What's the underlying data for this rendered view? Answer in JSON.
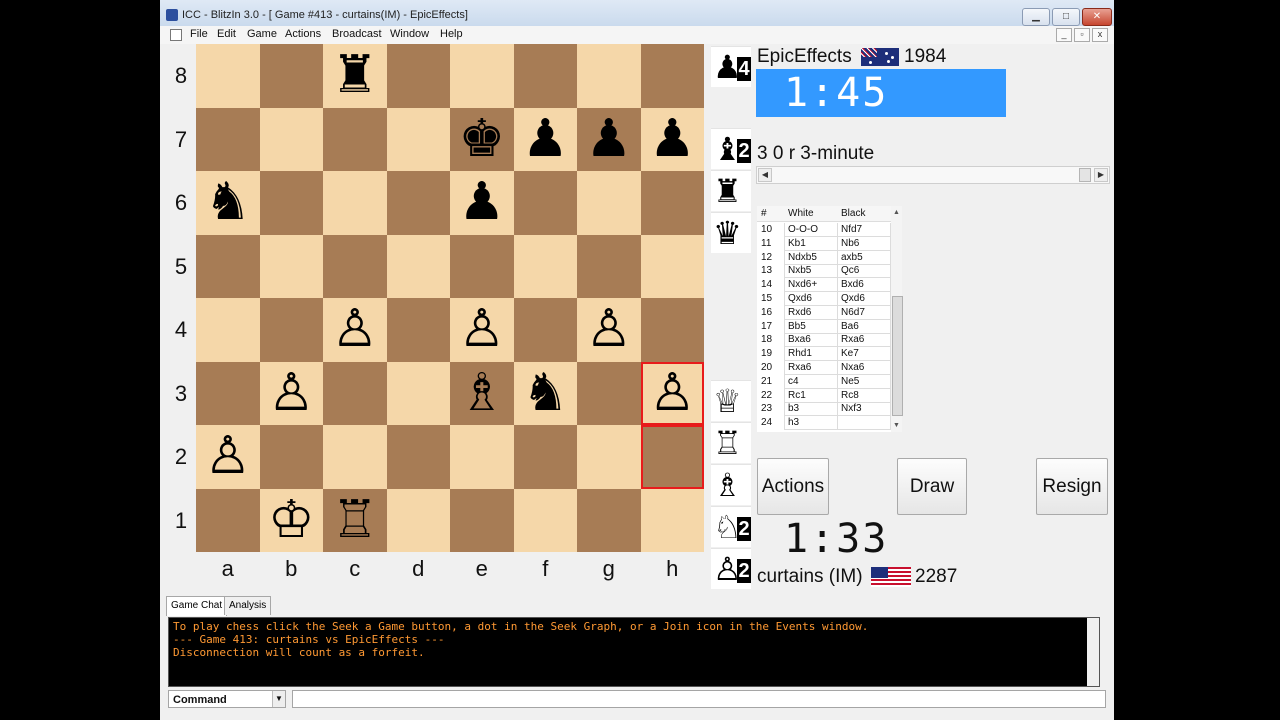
{
  "window": {
    "title": "ICC - BlitzIn 3.0 - [ Game #413 - curtains(IM) - EpicEffects]",
    "menu": [
      "File",
      "Edit",
      "Game",
      "Actions",
      "Broadcast",
      "Window",
      "Help"
    ]
  },
  "board": {
    "ranks": [
      "8",
      "7",
      "6",
      "5",
      "4",
      "3",
      "2",
      "1"
    ],
    "files": [
      "a",
      "b",
      "c",
      "d",
      "e",
      "f",
      "g",
      "h"
    ],
    "highlight_squares": [
      "h3",
      "h2"
    ],
    "pieces": [
      {
        "square": "c8",
        "glyph": "♜",
        "color": "black"
      },
      {
        "square": "e7",
        "glyph": "♚",
        "color": "black"
      },
      {
        "square": "f7",
        "glyph": "♟",
        "color": "black"
      },
      {
        "square": "g7",
        "glyph": "♟",
        "color": "black"
      },
      {
        "square": "h7",
        "glyph": "♟",
        "color": "black"
      },
      {
        "square": "a6",
        "glyph": "♞",
        "color": "black"
      },
      {
        "square": "e6",
        "glyph": "♟",
        "color": "black"
      },
      {
        "square": "c4",
        "glyph": "♙",
        "color": "white"
      },
      {
        "square": "e4",
        "glyph": "♙",
        "color": "white"
      },
      {
        "square": "g4",
        "glyph": "♙",
        "color": "white"
      },
      {
        "square": "b3",
        "glyph": "♙",
        "color": "white"
      },
      {
        "square": "e3",
        "glyph": "♗",
        "color": "white"
      },
      {
        "square": "f3",
        "glyph": "♞",
        "color": "black"
      },
      {
        "square": "h3",
        "glyph": "♙",
        "color": "white"
      },
      {
        "square": "a2",
        "glyph": "♙",
        "color": "white"
      },
      {
        "square": "b1",
        "glyph": "♔",
        "color": "white"
      },
      {
        "square": "c1",
        "glyph": "♖",
        "color": "white"
      }
    ]
  },
  "captured": {
    "top": [
      {
        "glyph": "♟",
        "count": "4"
      },
      {
        "glyph": "♝",
        "count": "2"
      },
      {
        "glyph": "♜",
        "count": ""
      },
      {
        "glyph": "♛",
        "count": ""
      }
    ],
    "bottom": [
      {
        "glyph": "♕",
        "count": ""
      },
      {
        "glyph": "♖",
        "count": ""
      },
      {
        "glyph": "♗",
        "count": ""
      },
      {
        "glyph": "♘",
        "count": "2"
      },
      {
        "glyph": "♙",
        "count": "2"
      }
    ]
  },
  "opponent": {
    "name": "EpicEffects",
    "rating": "1984",
    "clock": "1:45",
    "flag": "Australia"
  },
  "player": {
    "name": "curtains (IM)",
    "rating": "2287",
    "clock": "1:33",
    "flag": "United States"
  },
  "game_info": "3 0 r 3-minute",
  "moves": {
    "headers": [
      "#",
      "White",
      "Black"
    ],
    "rows": [
      [
        "10",
        "O-O-O",
        "Nfd7"
      ],
      [
        "11",
        "Kb1",
        "Nb6"
      ],
      [
        "12",
        "Ndxb5",
        "axb5"
      ],
      [
        "13",
        "Nxb5",
        "Qc6"
      ],
      [
        "14",
        "Nxd6+",
        "Bxd6"
      ],
      [
        "15",
        "Qxd6",
        "Qxd6"
      ],
      [
        "16",
        "Rxd6",
        "N6d7"
      ],
      [
        "17",
        "Bb5",
        "Ba6"
      ],
      [
        "18",
        "Bxa6",
        "Rxa6"
      ],
      [
        "19",
        "Rhd1",
        "Ke7"
      ],
      [
        "20",
        "Rxa6",
        "Nxa6"
      ],
      [
        "21",
        "c4",
        "Ne5"
      ],
      [
        "22",
        "Rc1",
        "Rc8"
      ],
      [
        "23",
        "b3",
        "Nxf3"
      ],
      [
        "24",
        "h3",
        ""
      ]
    ]
  },
  "buttons": {
    "actions": "Actions",
    "draw": "Draw",
    "resign": "Resign"
  },
  "tabs": [
    "Game Chat",
    "Analysis"
  ],
  "console_lines": [
    "To play chess click the Seek a Game button, a dot in the Seek Graph, or a Join icon in the Events window.",
    "--- Game 413: curtains vs EpicEffects ---",
    "Disconnection will count as a forfeit."
  ],
  "command": {
    "selected": "Command",
    "value": ""
  },
  "colors": {
    "light_square": "#f5d7a9",
    "dark_square": "#a77c55",
    "highlight": "#e81b1b",
    "clock_active": "#3399ff",
    "console_text": "#ff9933"
  },
  "icons": {
    "app": "icc-app-icon",
    "minimize": "minimize-icon",
    "maximize": "maximize-icon",
    "close": "close-icon"
  }
}
